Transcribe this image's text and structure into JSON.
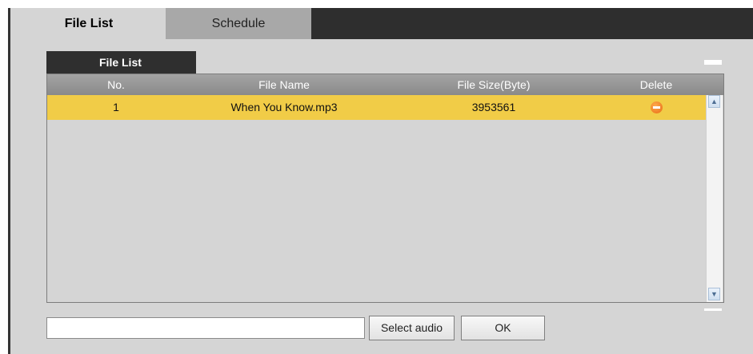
{
  "tabs": [
    {
      "label": "File List",
      "active": true
    },
    {
      "label": "Schedule",
      "active": false
    }
  ],
  "section": {
    "title": "File List"
  },
  "table": {
    "headers": [
      "No.",
      "File Name",
      "File Size(Byte)",
      "Delete"
    ],
    "rows": [
      {
        "no": "1",
        "file_name": "When You Know.mp3",
        "file_size": "3953561",
        "delete_icon": "delete-icon"
      }
    ]
  },
  "footer": {
    "path_value": "",
    "select_audio_label": "Select audio",
    "ok_label": "OK"
  },
  "colors": {
    "selected_row": "#f1cc47",
    "tab_bar": "#2e2e2e",
    "delete_icon": "#e86a12"
  }
}
